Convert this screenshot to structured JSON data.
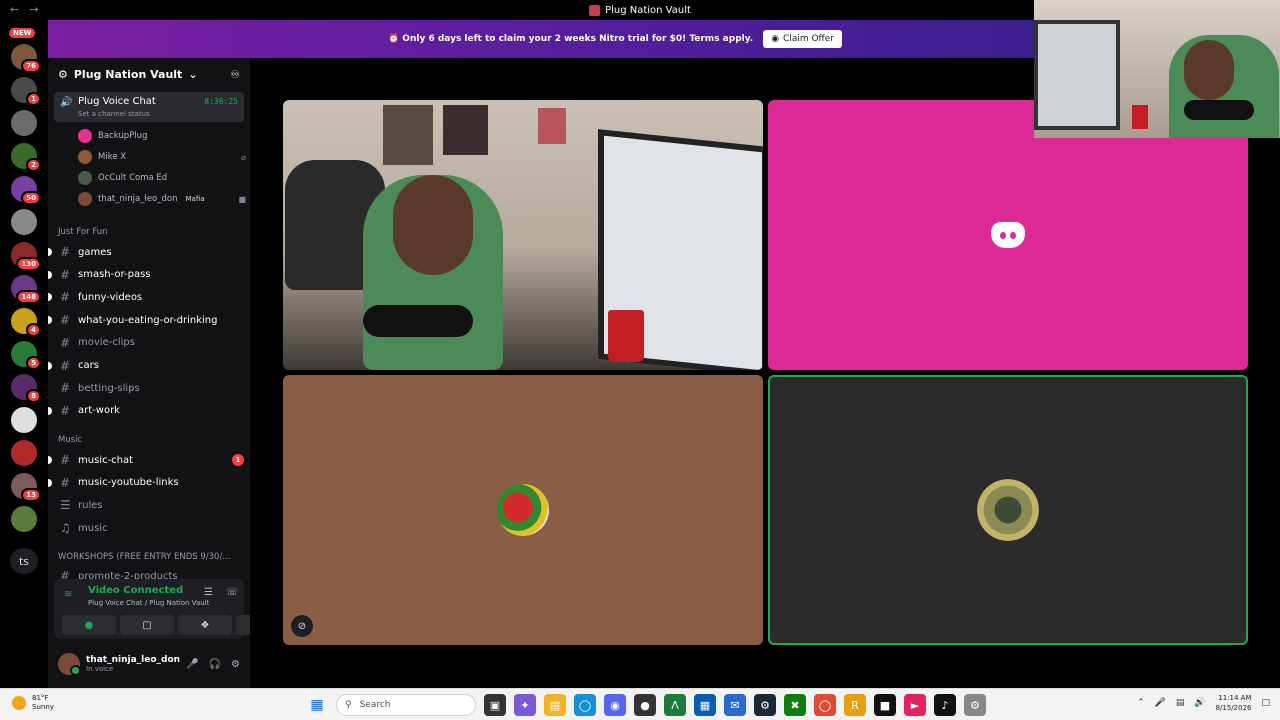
{
  "window": {
    "title": "Plug Nation Vault",
    "back_icon": "arrow-left-icon",
    "forward_icon": "arrow-right-icon"
  },
  "rail": {
    "new_label": "NEW",
    "servers": [
      {
        "color": "#7a5a3a",
        "badge": "76"
      },
      {
        "color": "#4a4a4a",
        "badge": "1"
      },
      {
        "color": "#6b6b6b",
        "badge": ""
      },
      {
        "color": "#3a6a2a",
        "badge": "2"
      },
      {
        "color": "#7a3fa0",
        "badge": "50"
      },
      {
        "color": "#8a8a8a",
        "badge": ""
      },
      {
        "color": "#8a2a2a",
        "badge": "130"
      },
      {
        "color": "#6a3a8a",
        "badge": "148"
      },
      {
        "color": "#c9a21a",
        "badge": "4"
      },
      {
        "color": "#2a7a3a",
        "badge": "5"
      },
      {
        "color": "#5a2a6a",
        "badge": "8"
      },
      {
        "color": "#dfdfdf",
        "badge": ""
      },
      {
        "color": "#b02a2a",
        "badge": ""
      },
      {
        "color": "#7a5a5a",
        "badge": "13"
      },
      {
        "color": "#5a7a3a",
        "badge": ""
      }
    ],
    "ts_label": "ts"
  },
  "banner": {
    "message": "Only 6 days left to claim your 2 weeks Nitro trial for $0! Terms apply.",
    "claim_label": "Claim Offer"
  },
  "sidebar": {
    "server_name": "Plug Nation Vault",
    "voice_channel": {
      "name": "Plug Voice Chat",
      "timer": "8:36:25",
      "status": "Set a channel status"
    },
    "members": [
      {
        "name": "BackupPlug",
        "avatar_color": "#e0358f",
        "tag": "",
        "right": ""
      },
      {
        "name": "Mike X",
        "avatar_color": "#8a5a3a",
        "tag": "",
        "right": "⌀"
      },
      {
        "name": "OcCult Coma Ed",
        "avatar_color": "#4a5a4a",
        "tag": "",
        "right": ""
      },
      {
        "name": "that_ninja_leo_don",
        "avatar_color": "#7b4a3a",
        "tag": "Mafia",
        "right": "■"
      }
    ],
    "categories": {
      "fun": "Just For Fun",
      "music": "Music",
      "workshops": "WORKSHOPS (FREE ENTRY ENDS 9/30/..."
    },
    "fun_channels": [
      {
        "name": "games",
        "unread": true
      },
      {
        "name": "smash-or-pass",
        "unread": true
      },
      {
        "name": "funny-videos",
        "unread": true
      },
      {
        "name": "what-you-eating-or-drinking",
        "unread": true
      },
      {
        "name": "movie-clips",
        "unread": false
      },
      {
        "name": "cars",
        "unread": true
      },
      {
        "name": "betting-slips",
        "unread": false
      },
      {
        "name": "art-work",
        "unread": true
      }
    ],
    "music_channels": [
      {
        "name": "music-chat",
        "unread": true,
        "mentions": "1"
      },
      {
        "name": "music-youtube-links",
        "unread": true,
        "mentions": ""
      },
      {
        "name": "rules",
        "unread": false,
        "mentions": ""
      },
      {
        "name": "music",
        "unread": false,
        "mentions": ""
      }
    ],
    "workshop_channel": "promote-2-products"
  },
  "voice_panel": {
    "title": "Video Connected",
    "subtitle": "Plug Voice Chat / Plug Nation Vault"
  },
  "user": {
    "name": "that_ninja_leo_don",
    "status": "In voice"
  },
  "taskbar": {
    "weather_temp": "81°F",
    "weather_desc": "Sunny",
    "search_placeholder": "Search",
    "time": "11:14 AM",
    "date": "8/15/2026"
  },
  "colors": {
    "accent_green": "#23a55a",
    "discord_pink": "#db2a96",
    "mention_red": "#f23f43"
  }
}
